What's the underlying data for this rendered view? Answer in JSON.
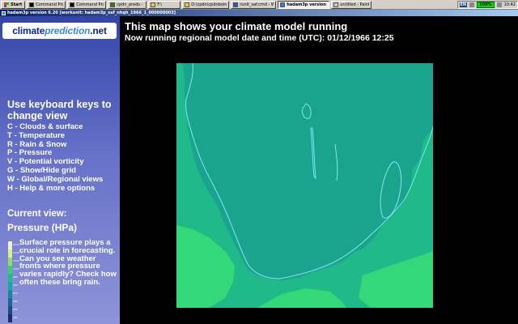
{
  "taskbar": {
    "start_label": "Start",
    "tasks": [
      {
        "label": "Command Prompt - c...",
        "active": false
      },
      {
        "label": "Command Prompt - ru...",
        "active": false
      },
      {
        "label": "cpdn_preds - Micros...",
        "active": false
      },
      {
        "label": "F:\\",
        "active": false
      },
      {
        "label": "D:\\cpdn\\cpdnboinc\\p...",
        "active": false
      },
      {
        "label": "runit_saf.cmd - Word...",
        "active": false
      },
      {
        "label": "hadam3p version 6...",
        "active": true
      },
      {
        "label": "untitled - Paint",
        "active": false
      }
    ],
    "language": "EN",
    "battery": "100%",
    "clock": "10:42"
  },
  "window": {
    "title": "hadam3p version 6.20 [workunit: hadam3p_saf_nhqh_1966_1_000000003]"
  },
  "sidebar": {
    "logo_part1": "climate",
    "logo_part2": "prediction",
    "logo_part3": ".net",
    "heading": "Use keyboard keys to change view",
    "keys": [
      "C - Clouds & surface",
      "T - Temperature",
      "R - Rain & Snow",
      "P - Pressure",
      "V - Potential vorticity",
      "G - Show/Hide grid",
      "W - Global/Regional views",
      "H - Help & more options"
    ],
    "current_view_label": "Current view:",
    "current_view_value": "Pressure (HPa)",
    "legend_ticks": [
      "1030",
      "1020",
      "1010",
      "1000",
      "990",
      "980",
      "970",
      "960",
      "950",
      "940"
    ],
    "legend_colors": [
      "#f4f4c8",
      "#d8f08c",
      "#8ee060",
      "#38d070",
      "#1fbd8a",
      "#1aa89a",
      "#16899c",
      "#156b92",
      "#184c80",
      "#1a2e6a"
    ],
    "info": "Surface pressure plays a crucial role in forecasting. Can you see weather fronts where pressure varies rapidly? Check how often these bring rain."
  },
  "main": {
    "title": "This map shows your climate model running",
    "subtitle": "Now running regional model date and time (UTC): 01/12/1966 12:25"
  },
  "map": {
    "ocean_color": "#1fb98a",
    "land_color": "#1aa48e",
    "high_color": "#33d878",
    "coast_color": "#7fe8f0"
  }
}
